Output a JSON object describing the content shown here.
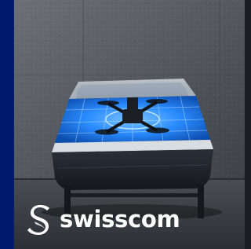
{
  "image": {
    "subject": "drone-docking-station",
    "colors": {
      "brand_bar": "#001a6e",
      "wall": "#5a5e63",
      "floor": "#3a3d42",
      "pad_glow": "#2a8cff",
      "housing": "#22262d",
      "logo_text": "#ffffff"
    }
  },
  "brand": {
    "name": "swisscom",
    "logo_icon": "swisscom-logo-icon"
  }
}
